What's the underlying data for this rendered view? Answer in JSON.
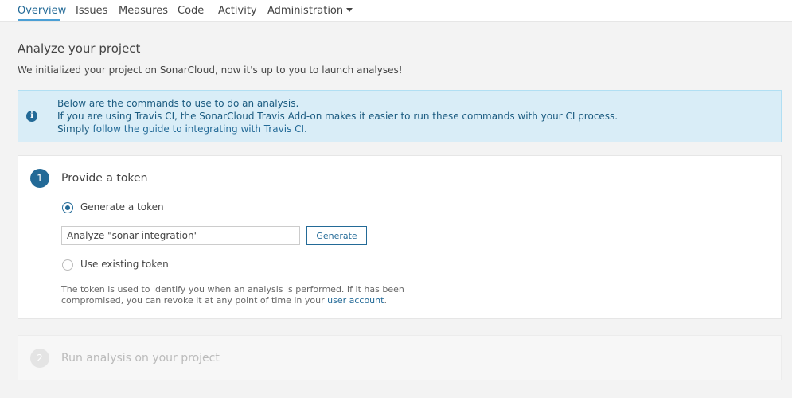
{
  "nav": {
    "tabs": [
      {
        "label": "Overview",
        "active": true
      },
      {
        "label": "Issues"
      },
      {
        "label": "Measures"
      },
      {
        "label": "Code"
      },
      {
        "label": "Activity"
      },
      {
        "label": "Administration"
      }
    ]
  },
  "page": {
    "title": "Analyze your project",
    "subtitle": "We initialized your project on SonarCloud, now it's up to you to launch analyses!"
  },
  "info": {
    "line1": "Below are the commands to use to do an analysis.",
    "line2": "If you are using Travis CI, the SonarCloud Travis Add-on makes it easier to run these commands with your CI process.",
    "line3_prefix": "Simply ",
    "line3_link": "follow the guide to integrating with Travis CI",
    "line3_suffix": "."
  },
  "step1": {
    "number": "1",
    "title": "Provide a token",
    "option_generate": "Generate a token",
    "token_input_value": "Analyze \"sonar-integration\"",
    "generate_button": "Generate",
    "option_existing": "Use existing token",
    "help_line1": "The token is used to identify you when an analysis is performed. If it has been",
    "help_line2_prefix": "compromised, you can revoke it at any point of time in your ",
    "help_line2_link": "user account",
    "help_line2_suffix": "."
  },
  "step2": {
    "number": "2",
    "title": "Run analysis on your project"
  },
  "colors": {
    "accent": "#236a97",
    "info_bg": "#d9edf7",
    "tab_underline": "#4b9fd5"
  }
}
